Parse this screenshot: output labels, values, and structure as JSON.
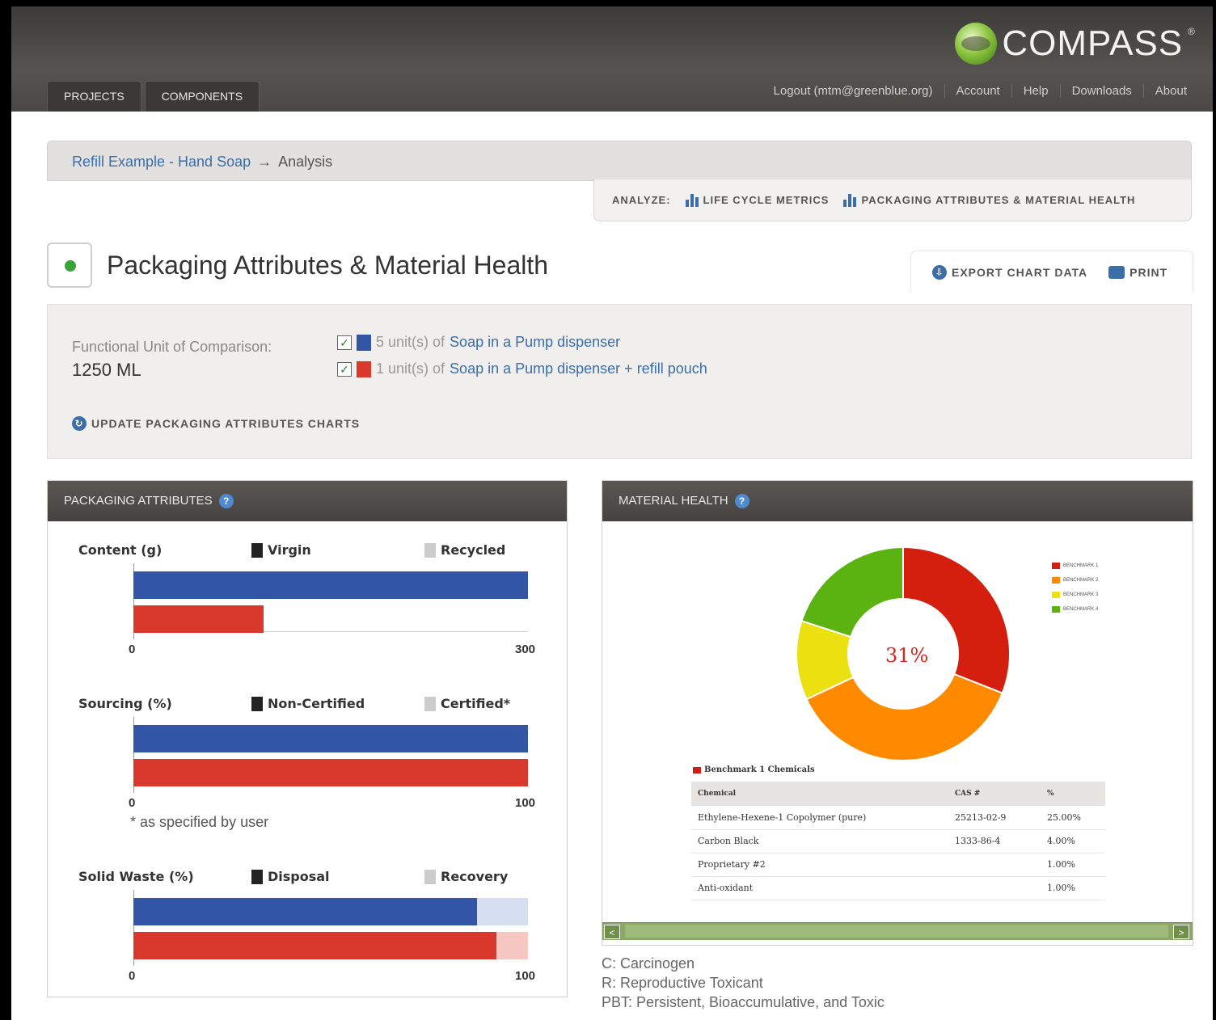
{
  "header": {
    "logo_text": "COMPASS",
    "logo_mark": "®",
    "tabs": [
      "PROJECTS",
      "COMPONENTS"
    ],
    "links": [
      "Logout (mtm@greenblue.org)",
      "Account",
      "Help",
      "Downloads",
      "About"
    ]
  },
  "breadcrumb": {
    "project": "Refill Example - Hand Soap",
    "arrow": "→",
    "current": "Analysis"
  },
  "analyze": {
    "label": "ANALYZE:",
    "options": [
      "LIFE CYCLE METRICS",
      "PACKAGING ATTRIBUTES & MATERIAL HEALTH"
    ]
  },
  "page": {
    "title": "Packaging Attributes & Material Health",
    "export_label": "EXPORT CHART DATA",
    "print_label": "PRINT"
  },
  "functional_unit": {
    "label": "Functional Unit of Comparison:",
    "value": "1250 ML",
    "scenarios": [
      {
        "prefix": "5 unit(s) of",
        "name": "Soap in a Pump dispenser",
        "color": "#3355a5",
        "checked": true
      },
      {
        "prefix": "1 unit(s) of",
        "name": "Soap in a Pump dispenser + refill pouch",
        "color": "#d9382c",
        "checked": true
      }
    ],
    "update_label": "UPDATE PACKAGING ATTRIBUTES CHARTS"
  },
  "packaging_attributes": {
    "title": "PACKAGING ATTRIBUTES",
    "help": "?",
    "groups": [
      {
        "heading": "Content (g)",
        "legend_a": "Virgin",
        "legend_b": "Recycled",
        "min": "0",
        "max": "300",
        "bars": [
          {
            "a": 1.0,
            "b": 0.0
          },
          {
            "a": 0.33,
            "b": 0.0
          }
        ]
      },
      {
        "heading": "Sourcing (%)",
        "legend_a": "Non-Certified",
        "legend_b": "Certified*",
        "min": "0",
        "max": "100",
        "bars": [
          {
            "a": 1.0,
            "b": 0.0
          },
          {
            "a": 1.0,
            "b": 0.0
          }
        ],
        "note": "* as specified by user"
      },
      {
        "heading": "Solid Waste (%)",
        "legend_a": "Disposal",
        "legend_b": "Recovery",
        "min": "0",
        "max": "100",
        "bars": [
          {
            "a": 0.87,
            "b": 0.13
          },
          {
            "a": 0.92,
            "b": 0.08
          }
        ]
      }
    ],
    "colors": {
      "series1": "#3355a5",
      "series1_light": "#d6dff0",
      "series2": "#d9382c",
      "series2_light": "#f6c6c0",
      "dark": "#222222",
      "light": "#cccccc"
    }
  },
  "material_health": {
    "title": "MATERIAL HEALTH",
    "help": "?",
    "center_label": "31%",
    "donut": [
      {
        "name": "Benchmark 1",
        "value": 31,
        "color": "#d41f0e"
      },
      {
        "name": "Benchmark 2",
        "value": 37,
        "color": "#ff8a00"
      },
      {
        "name": "Benchmark 3",
        "value": 12,
        "color": "#ebe010"
      },
      {
        "name": "Benchmark 4",
        "value": 20,
        "color": "#5bb312"
      }
    ],
    "legend": [
      "BENCHMARK 1",
      "BENCHMARK 2",
      "BENCHMARK 3",
      "BENCHMARK 4"
    ],
    "table_title": "Benchmark 1 Chemicals",
    "columns": [
      "Chemical",
      "CAS #",
      "%"
    ],
    "rows": [
      [
        "Ethylene-Hexene-1 Copolymer (pure)",
        "25213-02-9",
        "25.00%"
      ],
      [
        "Carbon Black",
        "1333-86-4",
        "4.00%"
      ],
      [
        "Proprietary #2",
        "",
        "1.00%"
      ],
      [
        "Anti-oxidant",
        "",
        "1.00%"
      ]
    ],
    "scroll_left": "<",
    "scroll_right": ">"
  },
  "footnotes": [
    "C: Carcinogen",
    "R: Reproductive Toxicant",
    "PBT: Persistent, Bioaccumulative, and Toxic"
  ]
}
